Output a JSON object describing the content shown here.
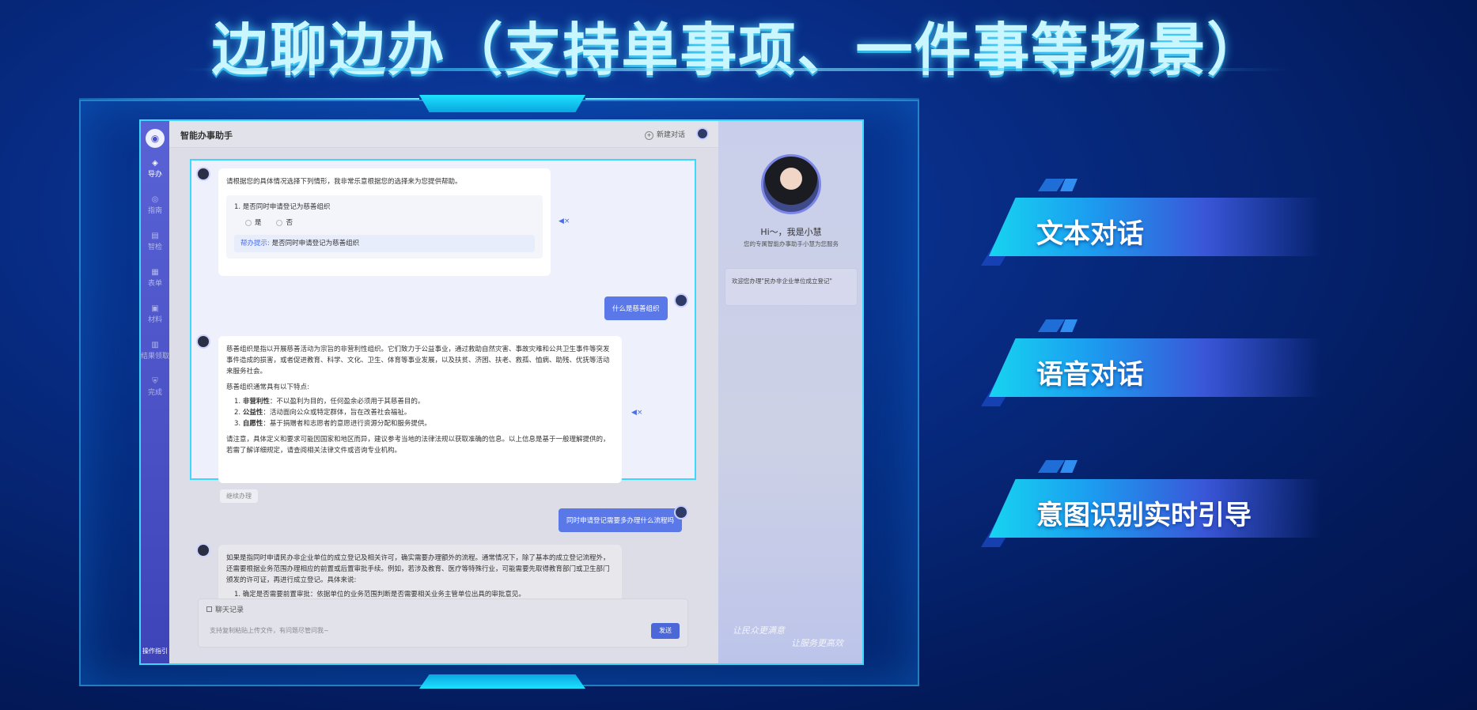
{
  "page": {
    "title": "边聊边办（支持单事项、一件事等场景）"
  },
  "app": {
    "name": "智能办事助手",
    "new_chat": "新建对话",
    "nav": [
      {
        "label": "导办",
        "icon": "layers-icon",
        "active": true
      },
      {
        "label": "指南",
        "icon": "compass-icon",
        "active": false
      },
      {
        "label": "智检",
        "icon": "document-icon",
        "active": false
      },
      {
        "label": "表单",
        "icon": "form-icon",
        "active": false
      },
      {
        "label": "材料",
        "icon": "folder-icon",
        "active": false
      },
      {
        "label": "结果领取",
        "icon": "receive-icon",
        "active": false
      },
      {
        "label": "完成",
        "icon": "shield-check-icon",
        "active": false
      }
    ],
    "nav_footer": "操作指引"
  },
  "chat": {
    "msg1": {
      "intro": "请根据您的具体情况选择下列情形，我非常乐意根据您的选择来为您提供帮助。",
      "question": "1. 是否同时申请登记为慈善组织",
      "option_yes": "是",
      "option_no": "否",
      "tip_label": "帮办提示:",
      "tip_text": "是否同时申请登记为慈善组织"
    },
    "user1": "什么是慈善组织",
    "msg2": {
      "p1": "慈善组织是指以开展慈善活动为宗旨的非营利性组织。它们致力于公益事业，通过救助自然灾害、事故灾难和公共卫生事件等突发事件造成的损害，或者促进教育、科学、文化、卫生、体育等事业发展，以及扶贫、济困、扶老、救孤、恤病、助残、优抚等活动来服务社会。",
      "p2": "慈善组织通常具有以下特点:",
      "items": [
        {
          "title": "非营利性",
          "text": "：不以盈利为目的，任何盈余必须用于其慈善目的。"
        },
        {
          "title": "公益性",
          "text": "：活动面向公众或特定群体，旨在改善社会福祉。"
        },
        {
          "title": "自愿性",
          "text": "：基于捐赠者和志愿者的意愿进行资源分配和服务提供。"
        }
      ],
      "p3": "请注意，具体定义和要求可能因国家和地区而异，建议参考当地的法律法规以获取准确的信息。以上信息是基于一般理解提供的，若需了解详细规定，请查阅相关法律文件或咨询专业机构。"
    },
    "continue": "继续办理",
    "user2": "同时申请登记需要多办理什么流程吗",
    "msg3": {
      "p1": "如果是指同时申请民办非企业单位的成立登记及相关许可，确实需要办理额外的流程。通常情况下，除了基本的成立登记流程外，还需要根据业务范围办理相应的前置或后置审批手续。例如，若涉及教育、医疗等特殊行业，可能需要先取得教育部门或卫生部门颁发的许可证，再进行成立登记。具体来说:",
      "p2": "1. 确定是否需要前置审批：依据单位的业务范围判断是否需要相关业务主管单位出具的审批意见。"
    },
    "history_label": "聊天记录",
    "input_placeholder": "支持复制粘贴上传文件，有问题尽管问我~",
    "send_label": "发送"
  },
  "assistant": {
    "greeting": "Hi～，我是小慧",
    "subtitle": "您的专属智能办事助手小慧为您服务",
    "welcome": "欢迎您办理\"民办非企业单位成立登记\"",
    "slogan1": "让民众更满意",
    "slogan2": "让服务更高效"
  },
  "features": [
    {
      "label": "文本对话"
    },
    {
      "label": "语音对话"
    },
    {
      "label": "意图识别实时引导"
    }
  ],
  "colors": {
    "accent_cyan": "#3ad7ff",
    "nav_purple": "#4a52c9",
    "user_bubble": "#5a78e8",
    "send_button": "#4c67d8"
  }
}
